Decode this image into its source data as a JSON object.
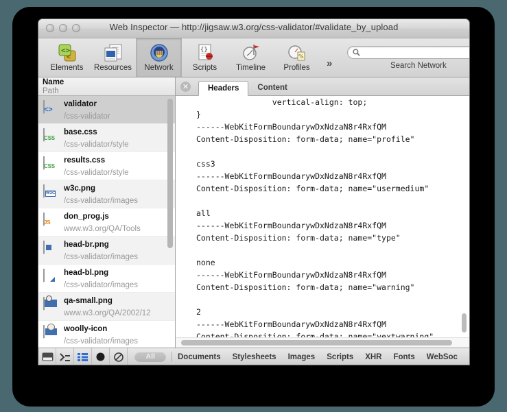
{
  "window": {
    "title": "Web Inspector — http://jigsaw.w3.org/css-validator/#validate_by_upload",
    "traffic_lights": [
      "close",
      "minimize",
      "zoom"
    ]
  },
  "toolbar": {
    "panels": [
      {
        "label": "Elements",
        "icon": "elements-icon",
        "selected": false
      },
      {
        "label": "Resources",
        "icon": "resources-icon",
        "selected": false
      },
      {
        "label": "Network",
        "icon": "network-icon",
        "selected": true
      },
      {
        "label": "Scripts",
        "icon": "scripts-icon",
        "selected": false
      },
      {
        "label": "Timeline",
        "icon": "timeline-icon",
        "selected": false
      },
      {
        "label": "Profiles",
        "icon": "profiles-icon",
        "selected": false
      }
    ],
    "overflow_label": "»",
    "search": {
      "value": "",
      "placeholder": "",
      "caption": "Search Network",
      "icon": "search-icon"
    }
  },
  "sidebar": {
    "header": {
      "name": "Name",
      "path": "Path"
    },
    "resources": [
      {
        "name": "validator",
        "path": "/css-validator",
        "icon": "html-file-icon",
        "selected": true
      },
      {
        "name": "base.css",
        "path": "/css-validator/style",
        "icon": "css-file-icon",
        "selected": false
      },
      {
        "name": "results.css",
        "path": "/css-validator/style",
        "icon": "css-file-icon",
        "selected": false
      },
      {
        "name": "w3c.png",
        "path": "/css-validator/images",
        "icon": "image-file-icon",
        "selected": false
      },
      {
        "name": "don_prog.js",
        "path": "www.w3.org/QA/Tools",
        "icon": "js-file-icon",
        "selected": false
      },
      {
        "name": "head-br.png",
        "path": "/css-validator/images",
        "icon": "image-file-icon",
        "selected": false
      },
      {
        "name": "head-bl.png",
        "path": "/css-validator/images",
        "icon": "image-file-icon",
        "selected": false
      },
      {
        "name": "qa-small.png",
        "path": "www.w3.org/QA/2002/12",
        "icon": "image-file-icon",
        "selected": false
      },
      {
        "name": "woolly-icon",
        "path": "/css-validator/images",
        "icon": "image-file-icon",
        "selected": false
      }
    ]
  },
  "detail": {
    "close_icon": "close-icon",
    "tabs": [
      {
        "label": "Headers",
        "active": true
      },
      {
        "label": "Content",
        "active": false
      }
    ],
    "body_text": "                vertical-align: top;\n}\n------WebKitFormBoundarywDxNdzaN8r4RxfQM\nContent-Disposition: form-data; name=\"profile\"\n\ncss3\n------WebKitFormBoundarywDxNdzaN8r4RxfQM\nContent-Disposition: form-data; name=\"usermedium\"\n\nall\n------WebKitFormBoundarywDxNdzaN8r4RxfQM\nContent-Disposition: form-data; name=\"type\"\n\nnone\n------WebKitFormBoundarywDxNdzaN8r4RxfQM\nContent-Disposition: form-data; name=\"warning\"\n\n2\n------WebKitFormBoundarywDxNdzaN8r4RxfQM\nContent-Disposition: form-data; name=\"vextwarning\"\n\ntrue\n------WebKitFormBoundarywDxNdzaN8r4RxfQM\nContent-Disposition: form-data; name=\"lang\""
  },
  "statusbar": {
    "buttons": [
      {
        "name": "toggle-console-drawer",
        "icon": "console-drawer-icon"
      },
      {
        "name": "toggle-sidebar",
        "icon": "sidebar-toggle-icon"
      },
      {
        "name": "list-view",
        "icon": "list-view-icon"
      },
      {
        "name": "record",
        "icon": "record-circle-icon"
      },
      {
        "name": "clear",
        "icon": "clear-prohibited-icon"
      }
    ],
    "all_pill": "All",
    "filters": [
      "Documents",
      "Stylesheets",
      "Images",
      "Scripts",
      "XHR",
      "Fonts",
      "WebSoc"
    ]
  },
  "colors": {
    "desktop": "#4a686f",
    "bezel": "#000000",
    "selection": "#cfcfcf",
    "accent_blue": "#1f6fd0",
    "css_green": "#43a047",
    "js_orange": "#e8820c"
  }
}
